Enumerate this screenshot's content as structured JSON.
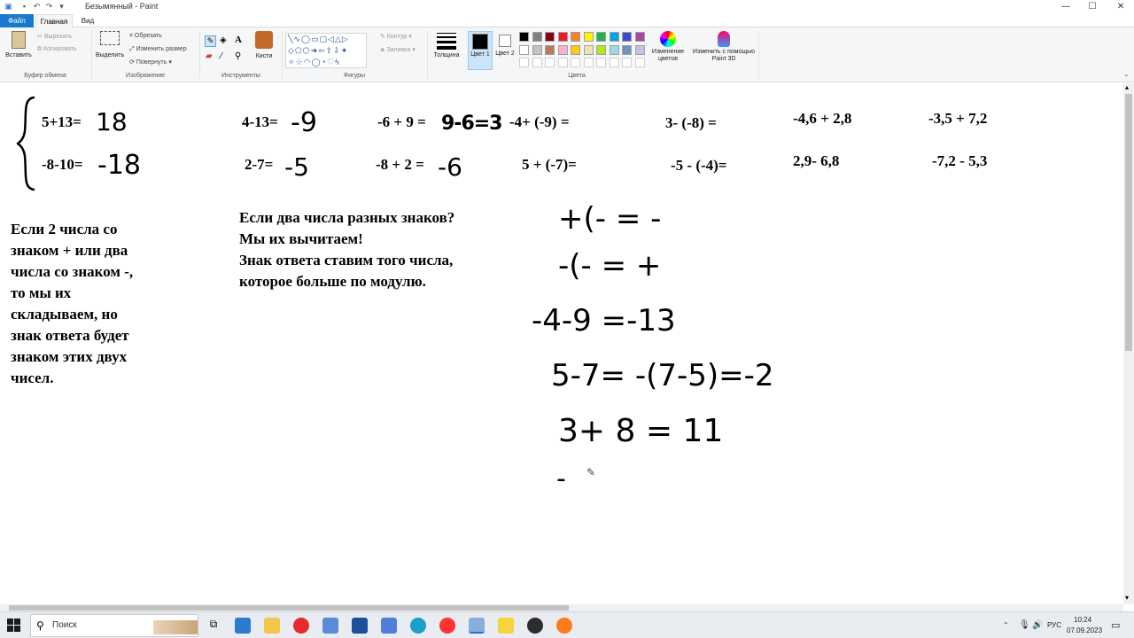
{
  "window": {
    "title": "Безымянный - Paint",
    "controls": {
      "minimize": "—",
      "maximize": "☐",
      "close": "✕"
    }
  },
  "tabs": [
    {
      "label": "Файл"
    },
    {
      "label": "Главная"
    },
    {
      "label": "Вид"
    }
  ],
  "ribbon": {
    "clipboard": {
      "paste": "Вставить",
      "cut": "Вырезать",
      "copy": "Копировать",
      "group": "Буфер обмена"
    },
    "image": {
      "select": "Выделить",
      "crop": "Обрезать",
      "resize": "Изменить размер",
      "rotate": "Повернуть",
      "group": "Изображение"
    },
    "tools": {
      "group": "Инструменты",
      "brushes": "Кисти"
    },
    "shapes": {
      "outline": "Контур",
      "fill": "Заливка",
      "group": "Фигуры"
    },
    "size": {
      "label": "Толщина"
    },
    "colors": {
      "color1": "Цвет 1",
      "color2": "Цвет 2",
      "edit": "Изменение цветов",
      "paint3d": "Изменить с помощью Paint 3D",
      "group": "Цвета",
      "palette_row1": [
        "#000000",
        "#7f7f7f",
        "#880015",
        "#ed1c24",
        "#ff7f27",
        "#fff200",
        "#22b14c",
        "#00a2e8",
        "#3f48cc",
        "#a349a4"
      ],
      "palette_row2": [
        "#ffffff",
        "#c3c3c3",
        "#b97a57",
        "#ffaec9",
        "#ffc90e",
        "#efe4b0",
        "#b5e61d",
        "#99d9ea",
        "#7092be",
        "#c8bfe7"
      ],
      "primary": "#000000",
      "secondary": "#ffffff"
    }
  },
  "canvas": {
    "row1": {
      "e1": "5+13=",
      "a1": "18",
      "e2": "4-13=",
      "a2": "-9",
      "e3": "-6 + 9 =",
      "a3": "9-6=3",
      "e4": "-4+ (-9) =",
      "e5": "3- (-8) =",
      "e6": "-4,6 + 2,8",
      "e7": "-3,5 + 7,2"
    },
    "row2": {
      "e1": "-8-10=",
      "a1": "-18",
      "e2": "2-7=",
      "a2": "-5",
      "e3": "-8 + 2 =",
      "a3": "-6",
      "e4": "5 + (-7)=",
      "e5": "-5 - (-4)=",
      "e6": "2,9- 6,8",
      "e7": "-7,2 - 5,3"
    },
    "rule_same_sign": [
      "Если 2 числа со",
      "знаком + или два",
      "числа со знаком -,",
      "то мы их",
      "складываем, но",
      "знак ответа будет",
      "знаком этих двух",
      "чисел."
    ],
    "rule_diff_sign": [
      "Если два числа разных знаков?",
      "Мы их вычитаем!",
      "Знак ответа ставим того числа,",
      "которое больше по модулю."
    ],
    "handwritten": {
      "h1": "+(- = -",
      "h2": "-(- = +",
      "h3": "-4-9 =-13",
      "h4": "5-7= -(7-5)=-2",
      "h5": "3+ 8 = 11",
      "h6": "-"
    }
  },
  "taskbar": {
    "search_placeholder": "Поиск",
    "lang": "РУС",
    "time": "10:24",
    "date": "07.09.2023"
  }
}
